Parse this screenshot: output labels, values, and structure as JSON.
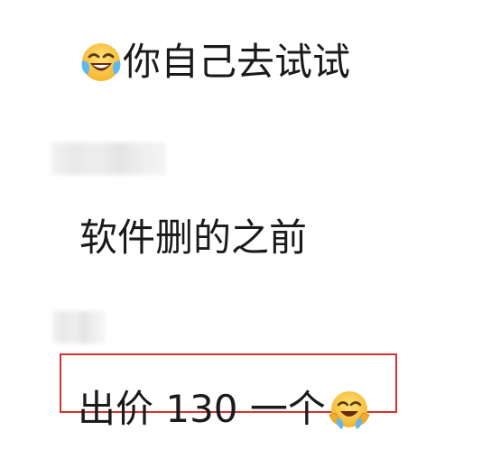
{
  "messages": [
    {
      "emoji": "face-with-tears-of-joy-icon",
      "text": "你自己去试试"
    },
    {
      "text": "软件删的之前"
    },
    {
      "text": "出价 130 一个",
      "emoji": "laughing-crying-face-icon"
    }
  ],
  "highlight_color": "#d9302e",
  "text_color": "#1a1a1a",
  "emoji_color": "#f7c62f"
}
